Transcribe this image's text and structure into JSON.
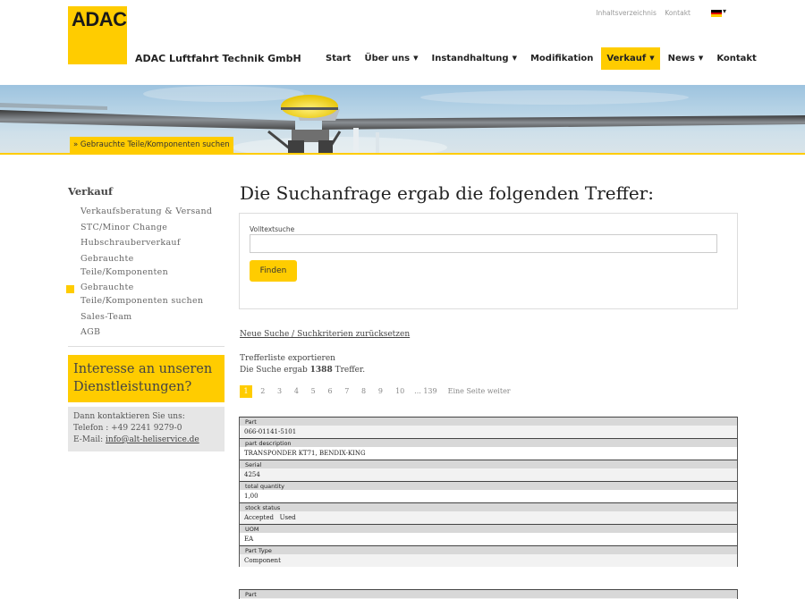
{
  "header": {
    "logo_text": "ADAC",
    "company_name": "ADAC Luftfahrt Technik GmbH",
    "utility_links": [
      "Inhaltsverzeichnis",
      "Kontakt"
    ],
    "language_flag": "flag-icon-de",
    "nav": [
      {
        "label": "Start",
        "dropdown": false,
        "active": false
      },
      {
        "label": "Über uns",
        "dropdown": true,
        "active": false
      },
      {
        "label": "Instandhaltung",
        "dropdown": true,
        "active": false
      },
      {
        "label": "Modifikation",
        "dropdown": false,
        "active": false
      },
      {
        "label": "Verkauf",
        "dropdown": true,
        "active": true
      },
      {
        "label": "News",
        "dropdown": true,
        "active": false
      },
      {
        "label": "Kontakt",
        "dropdown": false,
        "active": false
      }
    ]
  },
  "banner": {
    "breadcrumb": "» Gebrauchte Teile/Komponenten suchen"
  },
  "sidebar": {
    "title": "Verkauf",
    "items": [
      {
        "line1": "Verkaufsberatung & Versand",
        "line2": ""
      },
      {
        "line1": "STC/Minor Change",
        "line2": ""
      },
      {
        "line1": "Hubschrauberverkauf",
        "line2": ""
      },
      {
        "line1": "Gebrauchte",
        "line2": "Teile/Komponenten"
      },
      {
        "line1": "Gebrauchte",
        "line2": "Teile/Komponenten suchen"
      },
      {
        "line1": "Sales-Team",
        "line2": ""
      },
      {
        "line1": "AGB",
        "line2": ""
      }
    ],
    "current_index": 4,
    "promo_title": "Interesse an unseren Dienstleistungen?",
    "contact_intro": "Dann kontaktieren Sie uns:",
    "contact_phone": "Telefon : +49 2241 9279-0",
    "contact_email_label": "E-Mail: ",
    "contact_email": "info@alt-heliservice.de"
  },
  "main": {
    "title": "Die Suchanfrage ergab die folgenden Treffer:",
    "search_label": "Volltextsuche",
    "search_value": "",
    "search_button": "Finden",
    "reset_link": "Neue Suche / Suchkriterien zurücksetzen",
    "export_text": "Trefferliste exportieren",
    "result_prefix": "Die Suche ergab ",
    "result_count": "1388",
    "result_suffix": " Treffer.",
    "pager": {
      "pages": [
        "1",
        "2",
        "3",
        "4",
        "5",
        "6",
        "7",
        "8",
        "9",
        "10"
      ],
      "active": "1",
      "ellipsis": "... 139",
      "next": "Eine Seite weiter"
    },
    "records": [
      {
        "fields": [
          {
            "label": "Part",
            "value": "066-01141-5101"
          },
          {
            "label": "part description",
            "value": "TRANSPONDER KT71, BENDIX-KING"
          },
          {
            "label": "Serial",
            "value": "4254"
          },
          {
            "label": "total quantity",
            "value": "1,00"
          },
          {
            "label": "stock status",
            "value": "Accepted   Used"
          },
          {
            "label": "UOM",
            "value": "EA"
          },
          {
            "label": "Part Type",
            "value": "Component"
          }
        ]
      },
      {
        "fields": [
          {
            "label": "Part",
            "value": ""
          }
        ]
      }
    ]
  },
  "colors": {
    "accent": "#ffcc00",
    "text": "#333333",
    "table_header": "#d8d8d8"
  }
}
